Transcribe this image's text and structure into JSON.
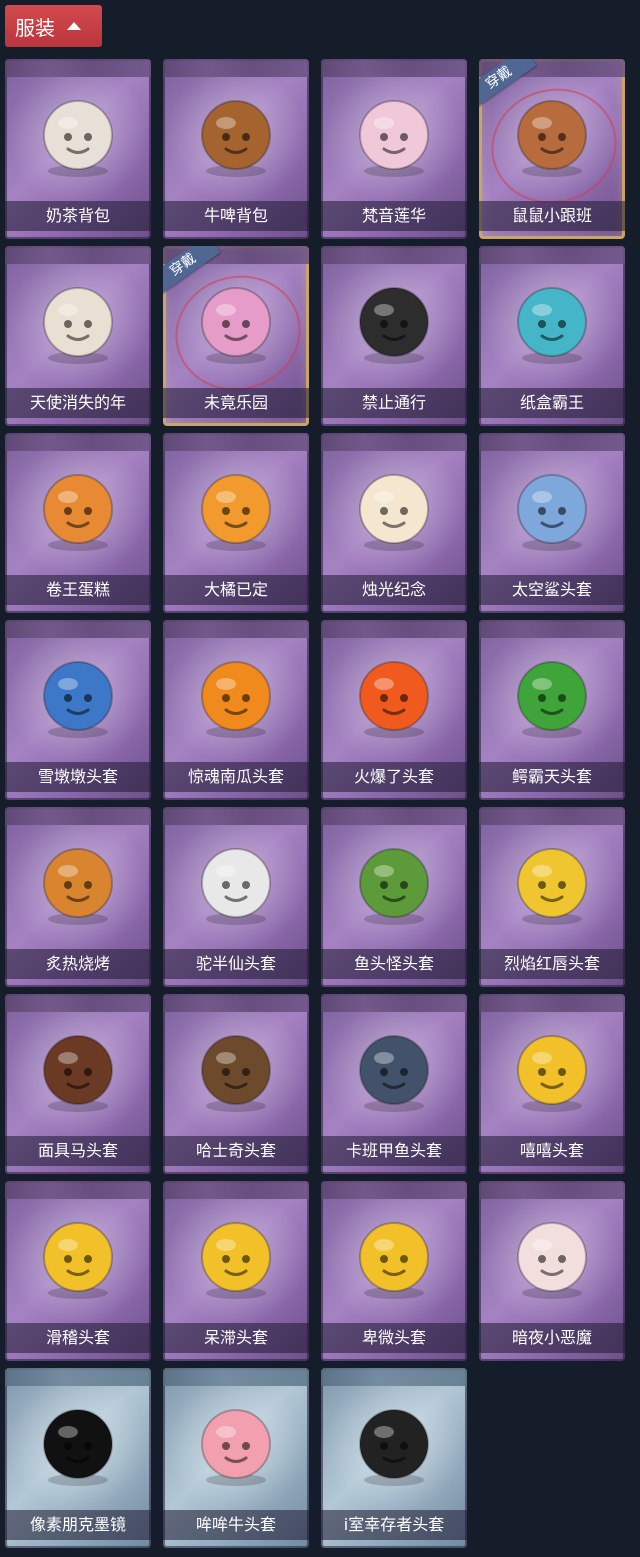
{
  "header": {
    "title": "服装"
  },
  "equipped_label": "穿戴",
  "items": [
    {
      "name": "奶茶背包",
      "icon": "milk-tea-backpack-icon",
      "theme": "purple",
      "equipped": false,
      "color": "#e8e0d6"
    },
    {
      "name": "牛啤背包",
      "icon": "cow-beer-backpack-icon",
      "theme": "purple",
      "equipped": false,
      "color": "#a5632f"
    },
    {
      "name": "梵音莲华",
      "icon": "lotus-character-icon",
      "theme": "purple",
      "equipped": false,
      "color": "#f1c8d8"
    },
    {
      "name": "鼠鼠小跟班",
      "icon": "hamster-pet-icon",
      "theme": "purple",
      "equipped": true,
      "color": "#b86b3c"
    },
    {
      "name": "天使消失的年",
      "icon": "angel-doll-icon",
      "theme": "purple",
      "equipped": false,
      "color": "#e9dfd2"
    },
    {
      "name": "未竟乐园",
      "icon": "star-girl-icon",
      "theme": "purple",
      "equipped": true,
      "color": "#e59cc8"
    },
    {
      "name": "禁止通行",
      "icon": "no-entry-sign-icon",
      "theme": "purple",
      "equipped": false,
      "color": "#2d2d2d"
    },
    {
      "name": "纸盒霸王",
      "icon": "box-dinosaur-icon",
      "theme": "purple",
      "equipped": false,
      "color": "#45b6c8"
    },
    {
      "name": "卷王蛋糕",
      "icon": "roll-cake-icon",
      "theme": "purple",
      "equipped": false,
      "color": "#e88a34"
    },
    {
      "name": "大橘已定",
      "icon": "orange-slice-icon",
      "theme": "purple",
      "equipped": false,
      "color": "#f29a2e"
    },
    {
      "name": "烛光纪念",
      "icon": "candle-icon",
      "theme": "purple",
      "equipped": false,
      "color": "#f5e6cf"
    },
    {
      "name": "太空鲨头套",
      "icon": "space-shark-helmet-icon",
      "theme": "purple",
      "equipped": false,
      "color": "#7ea7dc"
    },
    {
      "name": "雪墩墩头套",
      "icon": "snowman-helmet-icon",
      "theme": "purple",
      "equipped": false,
      "color": "#3d78c8"
    },
    {
      "name": "惊魂南瓜头套",
      "icon": "pumpkin-helmet-icon",
      "theme": "purple",
      "equipped": false,
      "color": "#f08a1c"
    },
    {
      "name": "火爆了头套",
      "icon": "fire-helmet-icon",
      "theme": "purple",
      "equipped": false,
      "color": "#f05a1e"
    },
    {
      "name": "鳄霸天头套",
      "icon": "crocodile-helmet-icon",
      "theme": "purple",
      "equipped": false,
      "color": "#3fa53a"
    },
    {
      "name": "炙热烧烤",
      "icon": "grilled-meat-icon",
      "theme": "purple",
      "equipped": false,
      "color": "#d9852f"
    },
    {
      "name": "驼半仙头套",
      "icon": "panda-sunglasses-icon",
      "theme": "purple",
      "equipped": false,
      "color": "#e8e8e8"
    },
    {
      "name": "鱼头怪头套",
      "icon": "fish-head-mask-icon",
      "theme": "purple",
      "equipped": false,
      "color": "#5d9a3a"
    },
    {
      "name": "烈焰红唇头套",
      "icon": "yellow-mouse-mask-icon",
      "theme": "purple",
      "equipped": false,
      "color": "#f0c630"
    },
    {
      "name": "面具马头套",
      "icon": "horse-mask-icon",
      "theme": "purple",
      "equipped": false,
      "color": "#6b3a24"
    },
    {
      "name": "哈士奇头套",
      "icon": "husky-mask-icon",
      "theme": "purple",
      "equipped": false,
      "color": "#6e4a2c"
    },
    {
      "name": "卡班甲鱼头套",
      "icon": "fish-helmet-icon",
      "theme": "purple",
      "equipped": false,
      "color": "#42526a"
    },
    {
      "name": "嘻嘻头套",
      "icon": "grin-emoji-helmet-icon",
      "theme": "purple",
      "equipped": false,
      "color": "#f2c028"
    },
    {
      "name": "滑稽头套",
      "icon": "funny-emoji-helmet-icon",
      "theme": "purple",
      "equipped": false,
      "color": "#f2c028"
    },
    {
      "name": "呆滞头套",
      "icon": "stare-emoji-helmet-icon",
      "theme": "purple",
      "equipped": false,
      "color": "#f2c028"
    },
    {
      "name": "卑微头套",
      "icon": "humble-emoji-helmet-icon",
      "theme": "purple",
      "equipped": false,
      "color": "#f2c028"
    },
    {
      "name": "暗夜小恶魔",
      "icon": "little-devil-icon",
      "theme": "purple",
      "equipped": false,
      "color": "#f3dede"
    },
    {
      "name": "像素朋克墨镜",
      "icon": "pixel-sunglasses-icon",
      "theme": "blue",
      "equipped": false,
      "color": "#111111"
    },
    {
      "name": "哞哞牛头套",
      "icon": "cow-helmet-icon",
      "theme": "blue",
      "equipped": false,
      "color": "#f2a0b0"
    },
    {
      "name": "i室幸存者头套",
      "icon": "gas-mask-icon",
      "theme": "blue",
      "equipped": false,
      "color": "#222222"
    }
  ]
}
